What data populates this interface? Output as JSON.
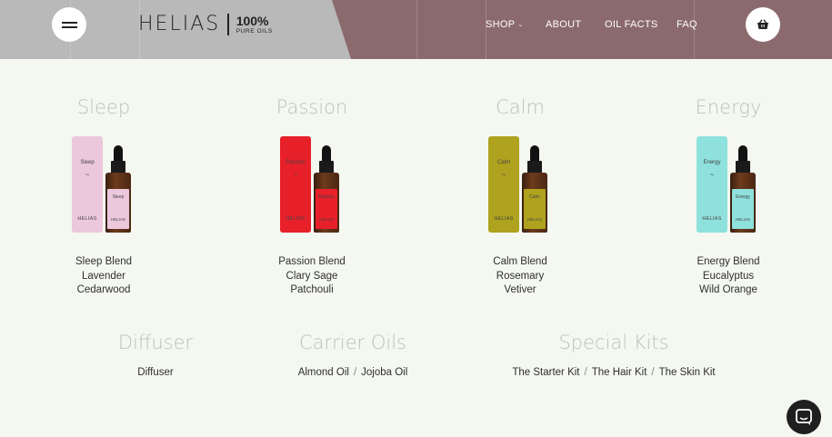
{
  "header": {
    "logo": {
      "wordmark": "HELIAS",
      "percent": "100%",
      "subtitle": "PURE OILS"
    },
    "nav": [
      {
        "label": "SHOP",
        "has_dropdown": true
      },
      {
        "label": "ABOUT"
      },
      {
        "label": "OIL FACTS"
      },
      {
        "label": "FAQ"
      }
    ],
    "icons": {
      "menu": "hamburger-icon",
      "cart": "basket-icon",
      "chat": "chat-icon"
    },
    "colors": {
      "bar_right": "#8b6a6e",
      "bar_left": "#b9b9ba"
    }
  },
  "products": [
    {
      "title": "Sleep",
      "box_label": "Sleep",
      "brand": "HELIAS",
      "color": "#ecc8dc",
      "ingredients": [
        "Sleep Blend",
        "Lavender",
        "Cedarwood"
      ]
    },
    {
      "title": "Passion",
      "box_label": "Passion",
      "brand": "HELIAS",
      "color": "#e8202a",
      "ingredients": [
        "Passion Blend",
        "Clary Sage",
        "Patchouli"
      ]
    },
    {
      "title": "Calm",
      "box_label": "Calm",
      "brand": "HELIAS",
      "color": "#aea21e",
      "ingredients": [
        "Calm Blend",
        "Rosemary",
        "Vetiver"
      ]
    },
    {
      "title": "Energy",
      "box_label": "Energy",
      "brand": "HELIAS",
      "color": "#8fe1de",
      "ingredients": [
        "Energy Blend",
        "Eucalyptus",
        "Wild Orange"
      ]
    }
  ],
  "categories": [
    {
      "title": "Diffuser",
      "links": [
        "Diffuser"
      ]
    },
    {
      "title": "Carrier Oils",
      "links": [
        "Almond Oil",
        "Jojoba Oil"
      ]
    },
    {
      "title": "Special Kits",
      "links": [
        "The Starter Kit",
        "The Hair Kit",
        "The Skin Kit"
      ]
    }
  ],
  "separator": "/",
  "dropdown_caret": "⌄",
  "tilde": "~"
}
